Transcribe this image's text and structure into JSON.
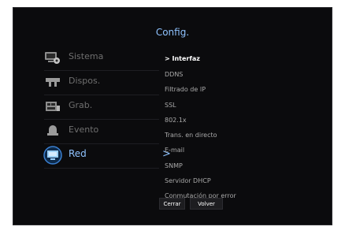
{
  "header": {
    "title": "Config."
  },
  "sidebar": {
    "items": [
      {
        "label": "Sistema",
        "icon": "monitor-gear-icon"
      },
      {
        "label": "Dispos.",
        "icon": "camera-icon"
      },
      {
        "label": "Grab.",
        "icon": "recorder-icon"
      },
      {
        "label": "Evento",
        "icon": "alarm-icon"
      },
      {
        "label": "Red",
        "icon": "network-monitor-icon",
        "active": true
      }
    ],
    "active_chevron": ">"
  },
  "submenu": {
    "items": [
      {
        "label": "> Interfaz",
        "selected": true
      },
      {
        "label": "DDNS"
      },
      {
        "label": "Filtrado de IP"
      },
      {
        "label": "SSL"
      },
      {
        "label": "802.1x"
      },
      {
        "label": "Trans. en directo"
      },
      {
        "label": "E-mail"
      },
      {
        "label": "SNMP"
      },
      {
        "label": "Servidor DHCP"
      },
      {
        "label": "Conmutación por error"
      }
    ]
  },
  "footer": {
    "close_label": "Cerrar",
    "back_label": "Volver"
  },
  "colors": {
    "accent": "#8fc3ff",
    "background": "#0b0b0d",
    "inactive_text": "#6f6f6f"
  }
}
